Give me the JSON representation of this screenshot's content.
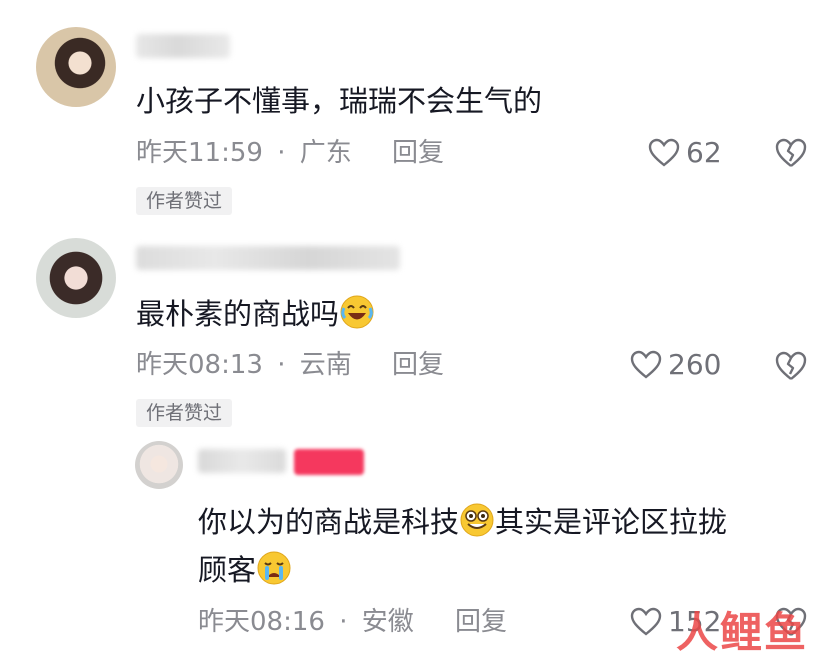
{
  "comments": [
    {
      "text": "小孩子不懂事，瑞瑞不会生气的",
      "time": "昨天11:59",
      "location": "广东",
      "reply_label": "回复",
      "likes": "62",
      "badge": "作者赞过"
    },
    {
      "text": "最朴素的商战吗",
      "time": "昨天08:13",
      "location": "云南",
      "reply_label": "回复",
      "likes": "260",
      "badge": "作者赞过"
    }
  ],
  "reply": {
    "text_line1_a": "你以为的商战是科技",
    "text_line1_b": "其实是评论区拉拢",
    "text_line2": "顾客",
    "time": "昨天08:16",
    "location": "安徽",
    "reply_label": "回复",
    "likes": "152"
  },
  "separator": "·",
  "watermark": "人鲤鱼",
  "colors": {
    "text": "#161823",
    "meta": "#8a8b91",
    "badge_bg": "#f1f1f2",
    "tag": "#f5385e"
  }
}
